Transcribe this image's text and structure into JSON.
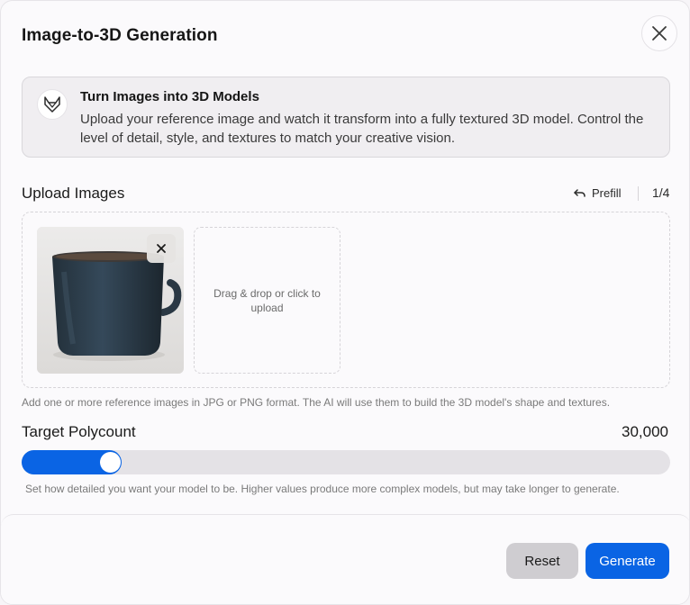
{
  "dialog": {
    "title": "Image-to-3D Generation"
  },
  "info": {
    "title": "Turn Images into 3D Models",
    "description": "Upload your reference image and watch it transform into a fully textured 3D model. Control the level of detail, style, and textures to match your creative vision.",
    "logo_icon": "fox-logo-icon"
  },
  "upload": {
    "label": "Upload Images",
    "prefill_label": "Prefill",
    "count": "1/4",
    "dropzone_text": "Drag & drop or click to upload",
    "helper": "Add one or more reference images in JPG or PNG format. The AI will use them to build the 3D model's shape and textures.",
    "images": [
      {
        "alt": "blue ceramic mug"
      }
    ]
  },
  "polycount": {
    "label": "Target Polycount",
    "value_text": "30,000",
    "slider_fraction": 0.117,
    "helper": "Set how detailed you want your model to be. Higher values produce more complex models, but may take longer to generate."
  },
  "footer": {
    "reset_label": "Reset",
    "generate_label": "Generate"
  },
  "colors": {
    "accent": "#0a64e4",
    "reset_bg": "#cfcdd1",
    "track": "#e4e2e6"
  }
}
